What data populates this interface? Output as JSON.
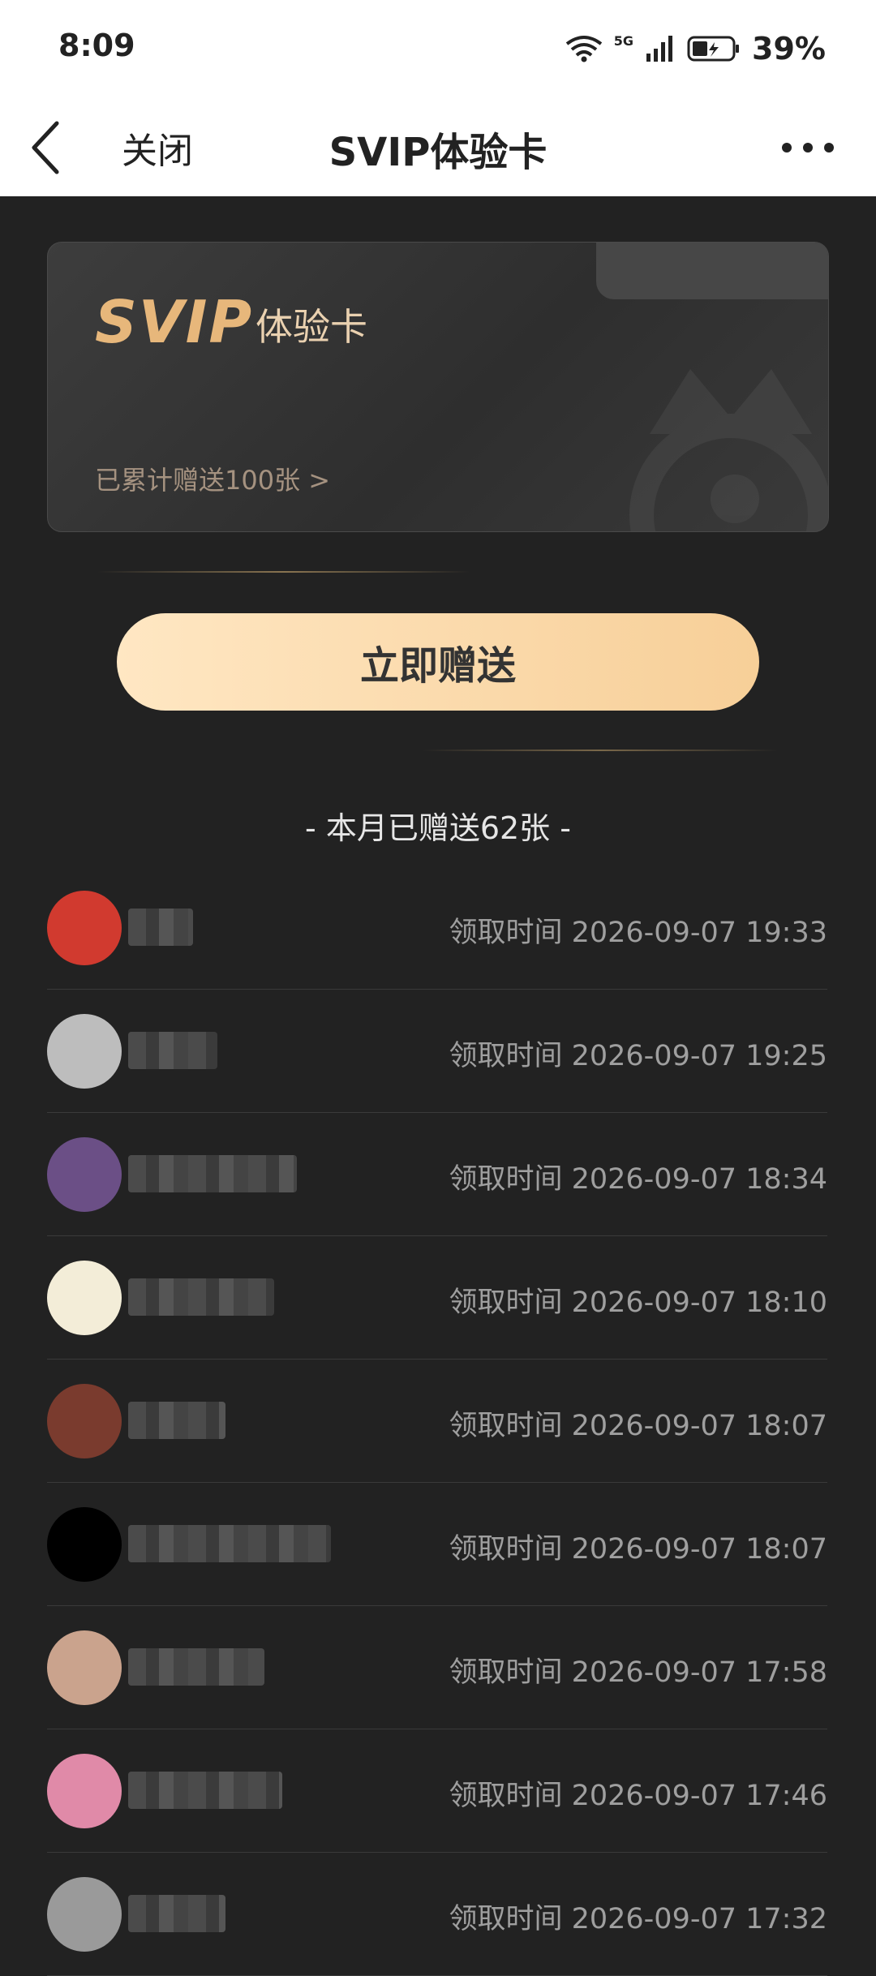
{
  "status": {
    "time": "8:09",
    "network": "5G",
    "battery": "39%"
  },
  "nav": {
    "close_label": "关闭",
    "title": "SVIP体验卡"
  },
  "card": {
    "logo": "SVIP",
    "subtitle": "体验卡",
    "total_sent": "已累计赠送100张 >"
  },
  "action": {
    "gift_button": "立即赠送"
  },
  "summary": {
    "month_sent": "- 本月已赠送62张 -"
  },
  "records": [
    {
      "time": "领取时间 2026-09-07 19:33",
      "avatar_color": "#d13a2f"
    },
    {
      "time": "领取时间 2026-09-07 19:25",
      "avatar_color": "#bdbdbd"
    },
    {
      "time": "领取时间 2026-09-07 18:34",
      "avatar_color": "#6b4f86"
    },
    {
      "time": "领取时间 2026-09-07 18:10",
      "avatar_color": "#f3edd8"
    },
    {
      "time": "领取时间 2026-09-07 18:07",
      "avatar_color": "#7a3b2e"
    },
    {
      "time": "领取时间 2026-09-07 18:07",
      "avatar_color": "#000000"
    },
    {
      "time": "领取时间 2026-09-07 17:58",
      "avatar_color": "#caa38d"
    },
    {
      "time": "领取时间 2026-09-07 17:46",
      "avatar_color": "#e08aa8"
    },
    {
      "time": "领取时间 2026-09-07 17:32",
      "avatar_color": "#9a9a9a"
    }
  ],
  "colors": {
    "accent": "#e7b77b",
    "button_start": "#ffe7c3",
    "button_end": "#f7cf98",
    "background": "#222222"
  }
}
